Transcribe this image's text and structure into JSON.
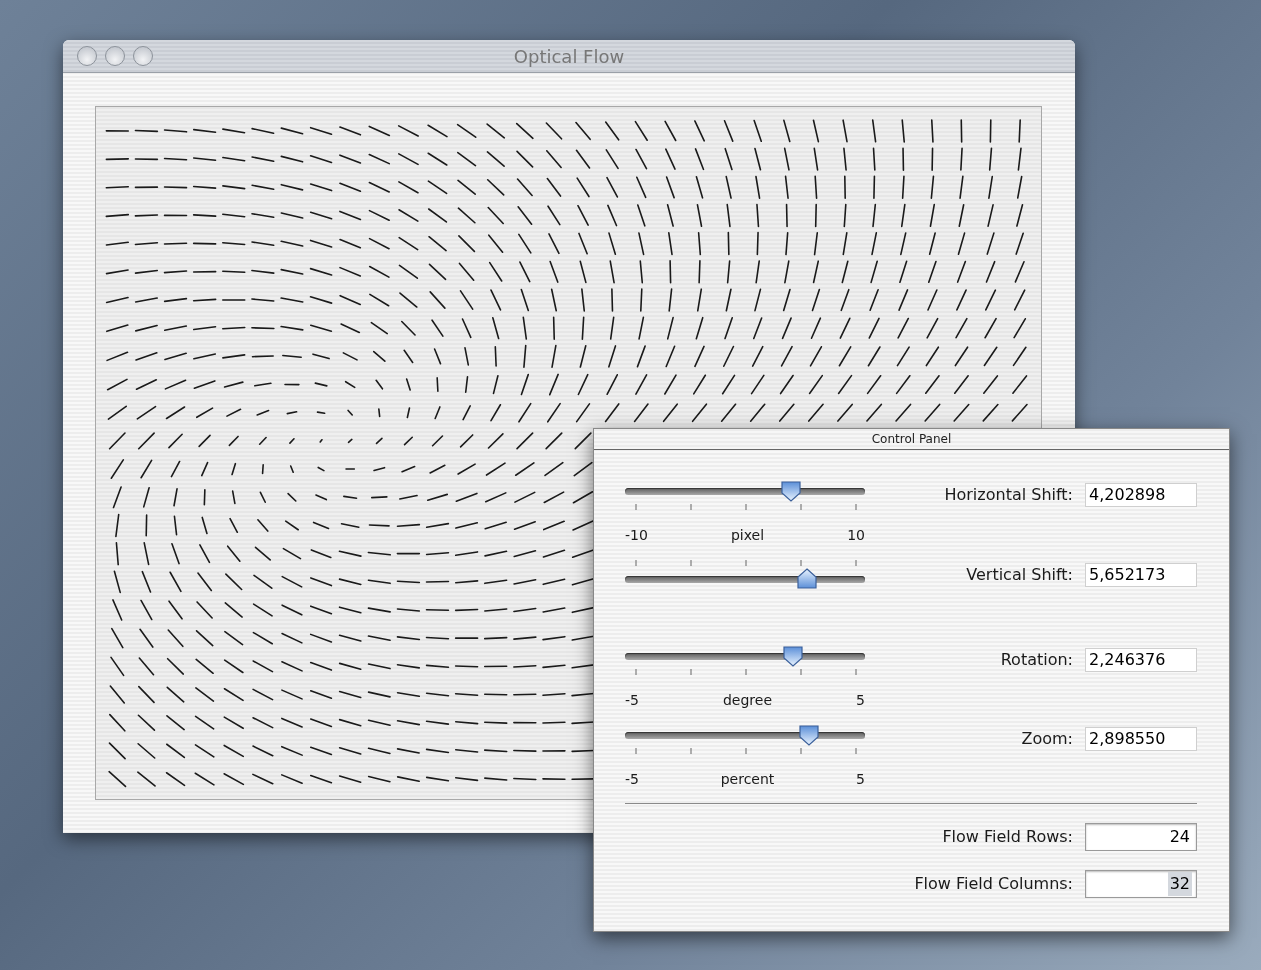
{
  "window": {
    "title": "Optical Flow"
  },
  "control_panel": {
    "title": "Control Panel",
    "rows": [
      {
        "kind": "slider",
        "thumb_up": false,
        "label": "Horizontal Shift:",
        "value": "4,202898",
        "level": 0.71
      },
      {
        "kind": "scale",
        "min": "-10",
        "unit": "pixel",
        "max": "10"
      },
      {
        "kind": "slider",
        "thumb_up": true,
        "label": "Vertical Shift:",
        "value": "5,652173",
        "level": 0.78
      },
      {
        "kind": "slider",
        "thumb_up": false,
        "label": "Rotation:",
        "value": "2,246376",
        "level": 0.72
      },
      {
        "kind": "scale",
        "min": "-5",
        "unit": "degree",
        "max": "5"
      },
      {
        "kind": "slider",
        "thumb_up": false,
        "label": "Zoom:",
        "value": "2,898550",
        "level": 0.79
      },
      {
        "kind": "scale",
        "min": "-5",
        "unit": "percent",
        "max": "5"
      }
    ],
    "fields": [
      {
        "label": "Flow Field Rows:",
        "value": "24",
        "selected": false
      },
      {
        "label": "Flow Field Columns:",
        "value": "32",
        "selected": true
      }
    ]
  }
}
